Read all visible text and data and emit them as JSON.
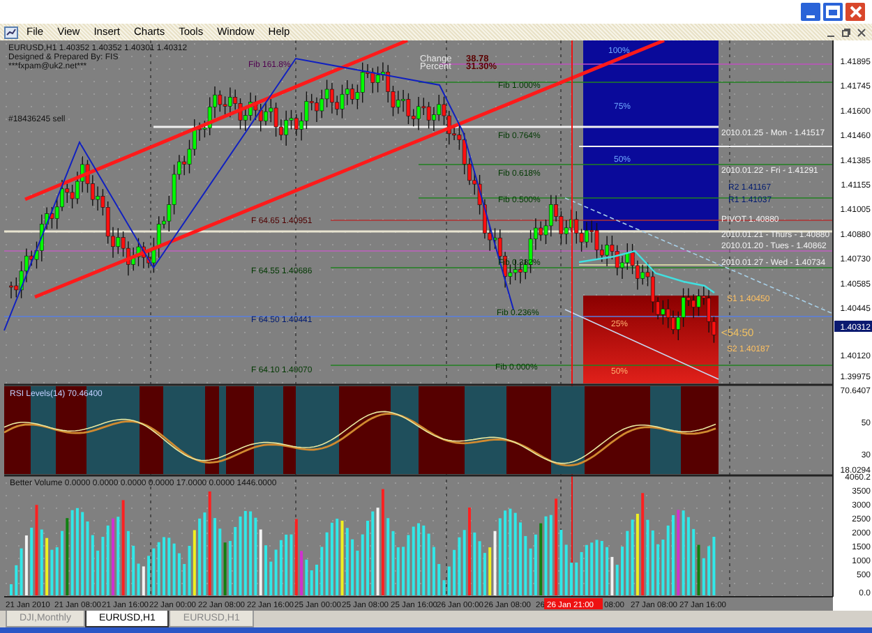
{
  "menu": [
    "File",
    "View",
    "Insert",
    "Charts",
    "Tools",
    "Window",
    "Help"
  ],
  "chart": {
    "symbol_line": "EURUSD,H1  1.40352 1.40352 1.40301 1.40312",
    "credit_lines": [
      "Designed & Prepared By: FIS",
      "***fxpam@uk2.net***"
    ],
    "order_label": "#18436245 sell",
    "stats": [
      {
        "label": "Change",
        "value": "38.78"
      },
      {
        "label": "Percent",
        "value": "31.30%"
      }
    ],
    "zone_labels": [
      "100%",
      "75%",
      "50%",
      "25%",
      "50%"
    ],
    "fib_labels": [
      "Fib 161.8%",
      "Fib 1.000%",
      "Fib 0.764%",
      "Fib 0.618%",
      "Fib 0.500%",
      "Fib 0.382%",
      "Fib 0.236%",
      "Fib 0.000%"
    ],
    "level_labels": [
      "F 64.65  1.40951",
      "F 64.55  1.40686",
      "F 64.50  1.40441",
      "F 64.10  1.40070"
    ],
    "pivot_labels": [
      "2010.01.25 - Mon - 1.41517",
      "2010.01.22 - Fri - 1.41291",
      "PIVOT 1.40880",
      "2010.01.21 - Thurs - 1.40880",
      "2010.01.20 - Tues - 1.40862",
      "2010.01.27 - Wed - 1.40734"
    ],
    "support_labels": [
      "R2 1.41167",
      "R1 1.41037",
      "S1 1.40450",
      "S2 1.40187"
    ],
    "countdown": "<54:50",
    "price_axis": [
      "1.41895",
      "1.41745",
      "1.41600",
      "1.41460",
      "1.41385",
      "1.41155",
      "1.41005",
      "1.40880",
      "1.40730",
      "1.40585",
      "1.40445",
      "1.40120",
      "1.39975"
    ],
    "current_price": "1.40312"
  },
  "rsi": {
    "title": "RSI Levels(14) 70.46400",
    "axis": [
      "70.6407",
      "50",
      "30",
      "18.0294"
    ]
  },
  "volume": {
    "title": "Better Volume 0.0000 0.0000 0.0000 0.0000 17.0000 0.0000 1446.0000",
    "axis": [
      "4060.2",
      "3500",
      "3000",
      "2500",
      "2000",
      "1500",
      "1000",
      "500",
      "0.0"
    ]
  },
  "time_axis": [
    {
      "label": "21 Jan 2010",
      "highlighted": false
    },
    {
      "label": "21 Jan 08:00",
      "highlighted": false
    },
    {
      "label": "21 Jan 16:00",
      "highlighted": false
    },
    {
      "label": "22 Jan 00:00",
      "highlighted": false
    },
    {
      "label": "22 Jan 08:00",
      "highlighted": false
    },
    {
      "label": "22 Jan 16:00",
      "highlighted": false
    },
    {
      "label": "25 Jan 00:00",
      "highlighted": false
    },
    {
      "label": "25 Jan 08:00",
      "highlighted": false
    },
    {
      "label": "25 Jan 16:00",
      "highlighted": false
    },
    {
      "label": "26 Jan 00:00",
      "highlighted": false
    },
    {
      "label": "26 Jan 08:00",
      "highlighted": false
    },
    {
      "label": "26",
      "highlighted": false
    },
    {
      "label": "26 Jan 21:00",
      "highlighted": true
    },
    {
      "label": "08:00",
      "highlighted": false
    },
    {
      "label": "27 Jan 08:00",
      "highlighted": false
    },
    {
      "label": "27 Jan 16:00",
      "highlighted": false
    }
  ],
  "tabs": [
    {
      "label": "DJI,Monthly",
      "selected": false
    },
    {
      "label": "EURUSD,H1",
      "selected": true
    },
    {
      "label": "EURUSD,H1",
      "selected": false
    }
  ]
}
